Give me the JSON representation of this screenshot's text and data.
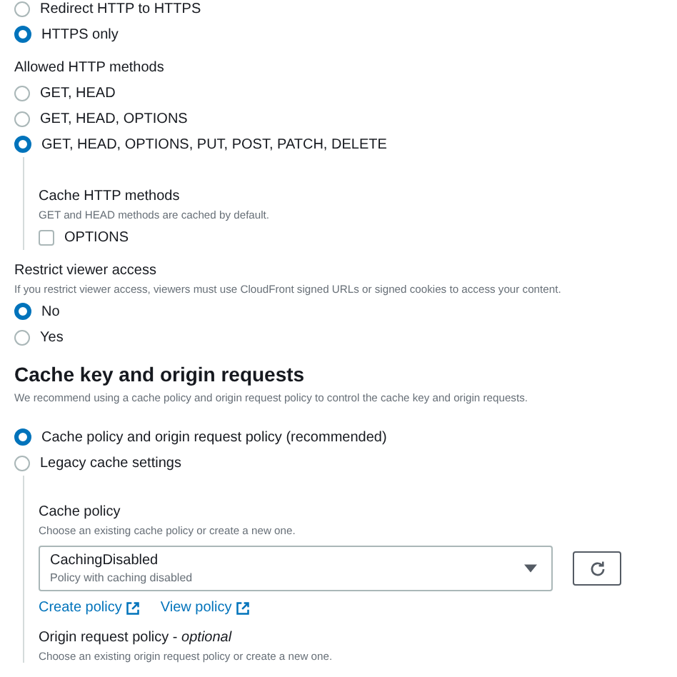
{
  "viewer_protocol": {
    "options": [
      {
        "label": "Redirect HTTP to HTTPS",
        "selected": false
      },
      {
        "label": "HTTPS only",
        "selected": true
      }
    ]
  },
  "allowed_methods": {
    "label": "Allowed HTTP methods",
    "options": [
      {
        "label": "GET, HEAD",
        "selected": false
      },
      {
        "label": "GET, HEAD, OPTIONS",
        "selected": false
      },
      {
        "label": "GET, HEAD, OPTIONS, PUT, POST, PATCH, DELETE",
        "selected": true
      }
    ],
    "cache_methods": {
      "label": "Cache HTTP methods",
      "description": "GET and HEAD methods are cached by default.",
      "options": [
        {
          "label": "OPTIONS",
          "checked": false
        }
      ]
    }
  },
  "restrict_viewer_access": {
    "label": "Restrict viewer access",
    "description": "If you restrict viewer access, viewers must use CloudFront signed URLs or signed cookies to access your content.",
    "options": [
      {
        "label": "No",
        "selected": true
      },
      {
        "label": "Yes",
        "selected": false
      }
    ]
  },
  "cache_key": {
    "heading": "Cache key and origin requests",
    "description": "We recommend using a cache policy and origin request policy to control the cache key and origin requests.",
    "options": [
      {
        "label": "Cache policy and origin request policy (recommended)",
        "selected": true
      },
      {
        "label": "Legacy cache settings",
        "selected": false
      }
    ],
    "cache_policy": {
      "label": "Cache policy",
      "description": "Choose an existing cache policy or create a new one.",
      "value": "CachingDisabled",
      "value_description": "Policy with caching disabled",
      "links": [
        "Create policy",
        "View policy"
      ]
    },
    "origin_request_policy": {
      "label": "Origin request policy - *optional*",
      "description": "Choose an existing origin request policy or create a new one."
    }
  }
}
